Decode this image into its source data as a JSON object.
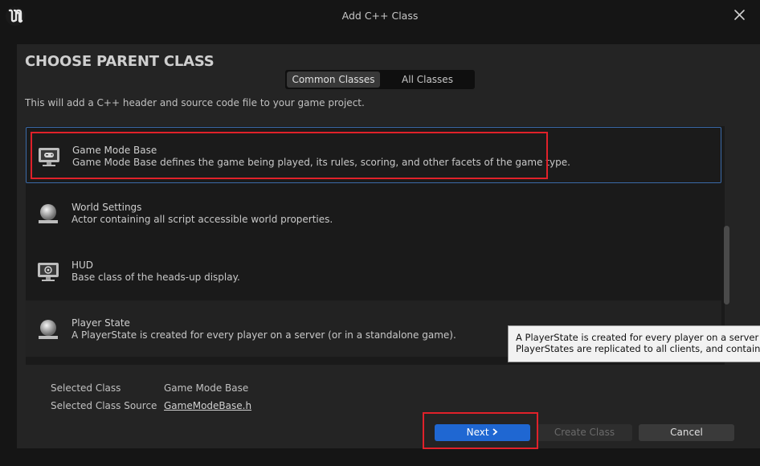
{
  "window": {
    "title": "Add C++ Class",
    "logo_icon": "unreal-engine-logo",
    "close_icon": "close-icon"
  },
  "header": {
    "heading": "CHOOSE PARENT CLASS",
    "tabs": [
      {
        "label": "Common Classes",
        "active": true
      },
      {
        "label": "All Classes",
        "active": false
      }
    ],
    "description": "This will add a C++ header and source code file to your game project."
  },
  "classes": [
    {
      "name": "Game Mode Base",
      "description": "Game Mode Base defines the game being played, its rules, scoring, and other facets of the game type.",
      "icon": "game-mode-icon",
      "selected": true
    },
    {
      "name": "World Settings",
      "description": "Actor containing all script accessible world properties.",
      "icon": "actor-sphere-icon",
      "selected": false
    },
    {
      "name": "HUD",
      "description": "Base class of the heads-up display.",
      "icon": "hud-icon",
      "selected": false
    },
    {
      "name": "Player State",
      "description": "A PlayerState is created for every player on a server (or in a standalone game).",
      "icon": "actor-sphere-icon",
      "selected": false
    }
  ],
  "selection": {
    "class_label": "Selected Class",
    "class_value": "Game Mode Base",
    "source_label": "Selected Class Source",
    "source_value": "GameModeBase.h"
  },
  "buttons": {
    "next": "Next",
    "create": "Create Class",
    "cancel": "Cancel"
  },
  "tooltip": {
    "line1": "A PlayerState is created for every player on a server (or in a standalone game).",
    "line2": "PlayerStates are replicated to all clients, and contain network game relevant information about the player, such as playername, score, etc."
  },
  "colors": {
    "accent": "#1f67d2",
    "highlight": "#e0212a",
    "selected_border": "#3a6aa8"
  }
}
